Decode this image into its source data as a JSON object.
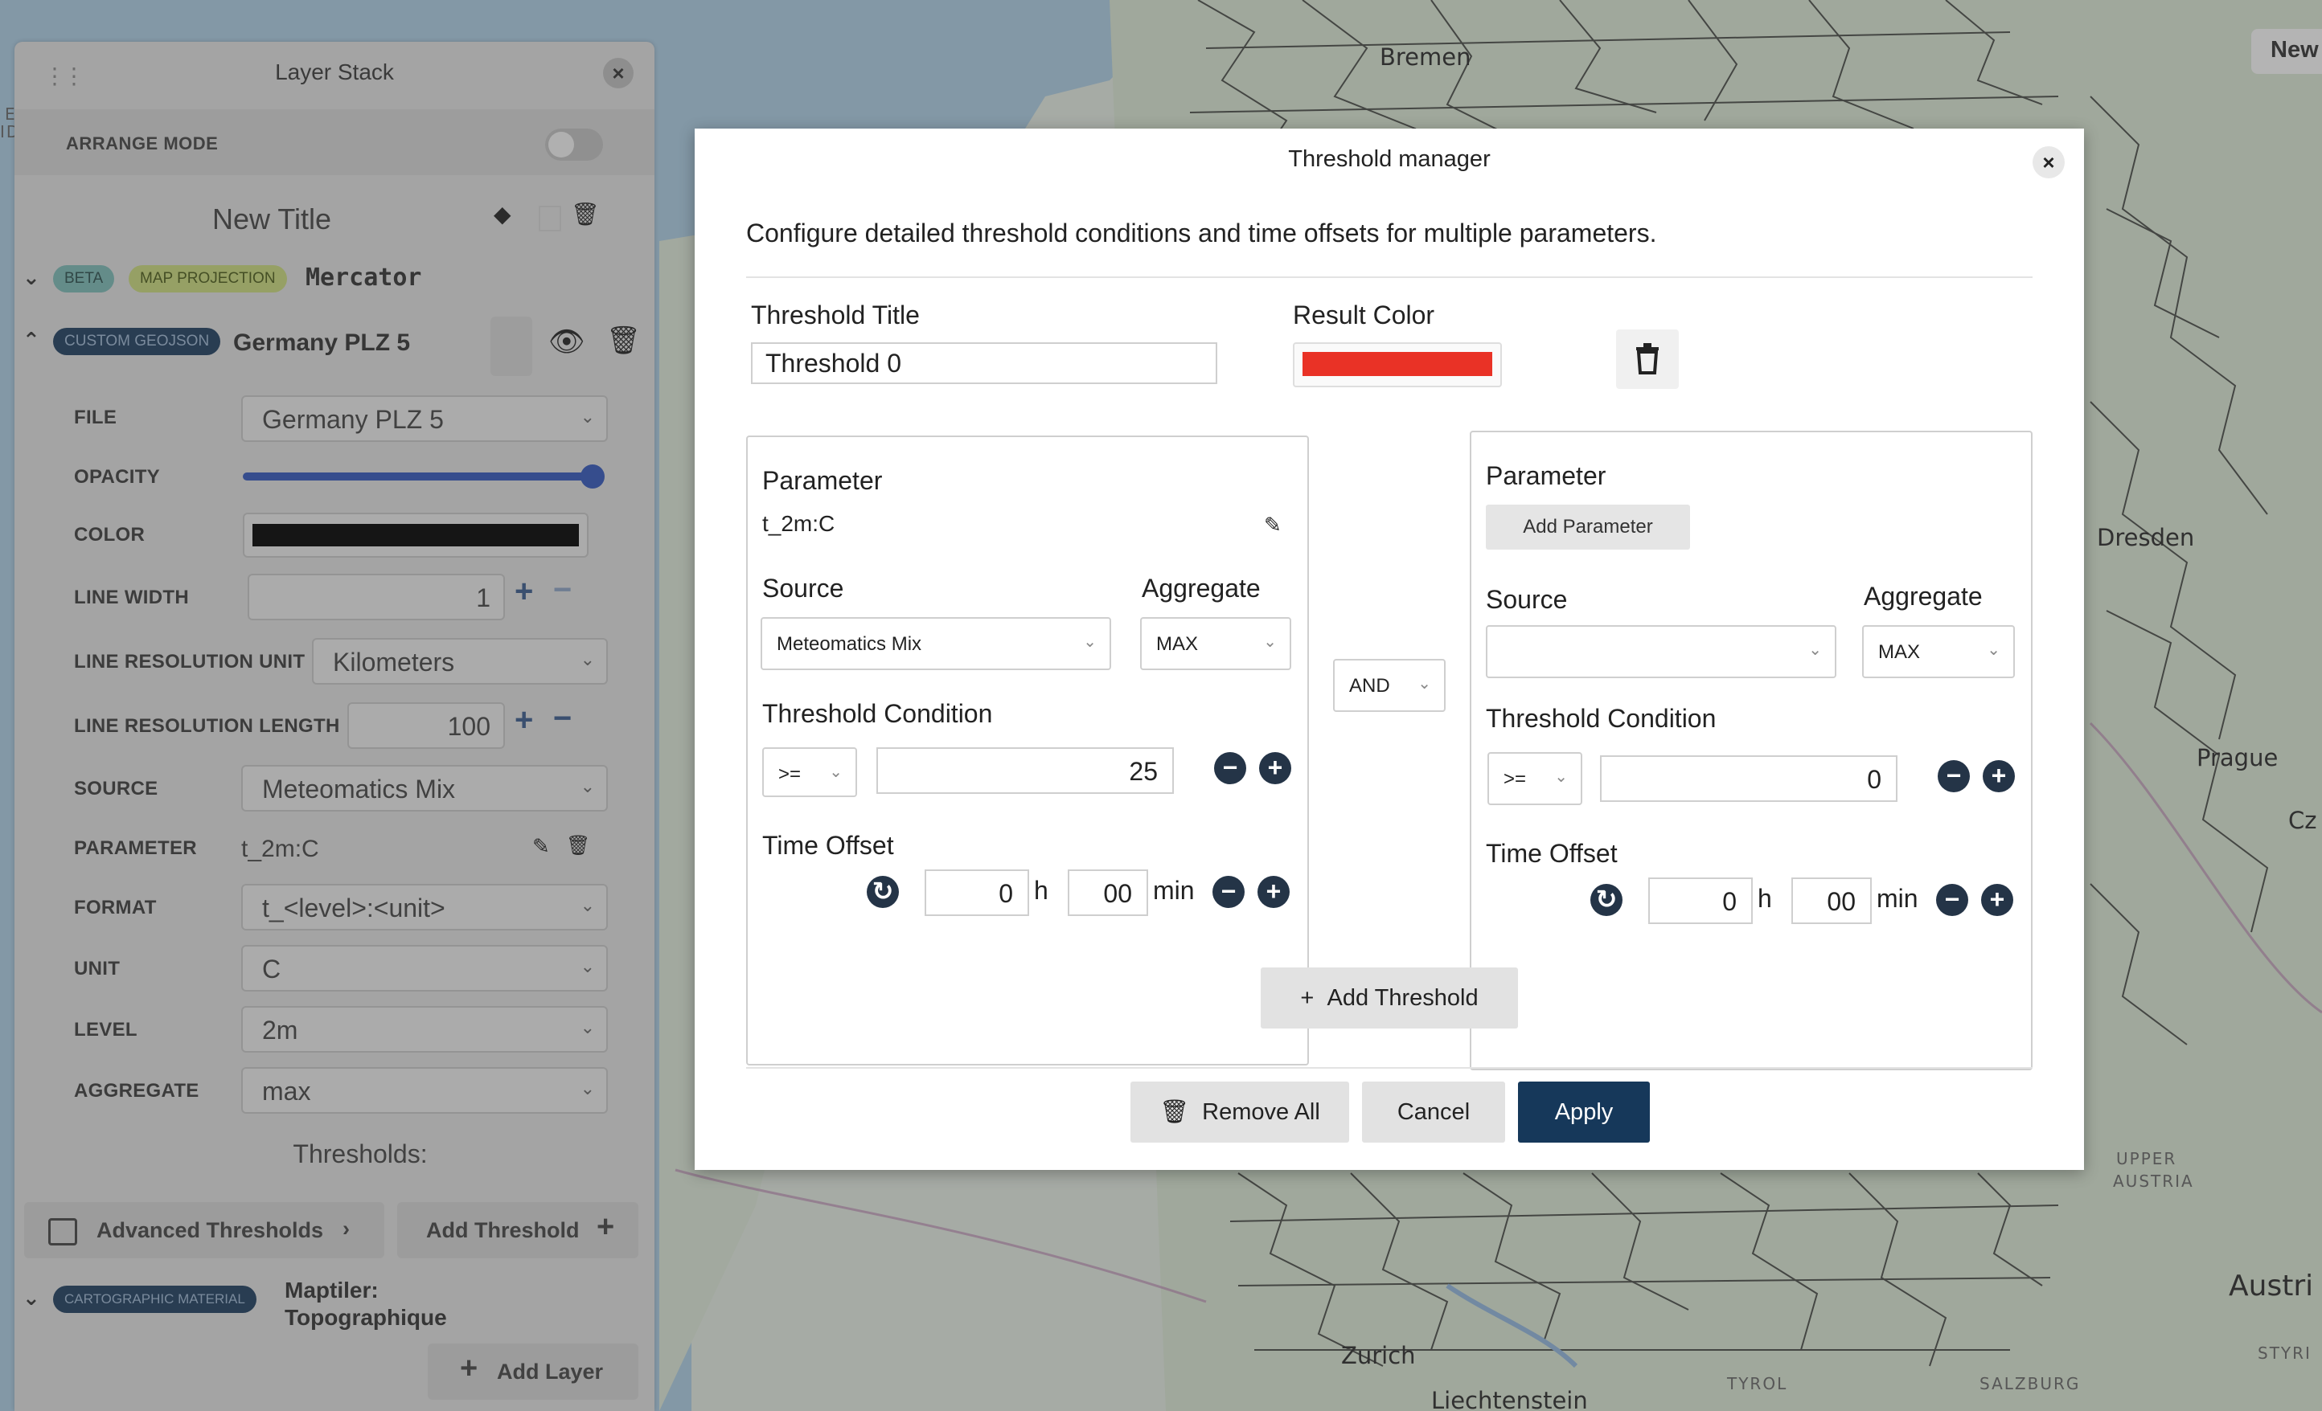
{
  "map": {
    "labels": {
      "bremen": "Bremen",
      "dresden": "Dresden",
      "prague": "Prague",
      "cz": "Cz",
      "zurich": "Zurich",
      "liechtenstein": "Liechtenstein",
      "austria": "Austri",
      "upper_austria_1": "UPPER",
      "upper_austria_2": "AUSTRIA",
      "tyrol": "TYROL",
      "salzburg": "SALZBURG",
      "styria": "STYRI",
      "edge_1": "E",
      "edge_2": "ID"
    },
    "new_button": "New"
  },
  "layer_stack": {
    "title": "Layer Stack",
    "arrange_mode_label": "ARRANGE MODE",
    "group_title": "New Title",
    "mercator": {
      "badges": [
        "BETA",
        "MAP PROJECTION"
      ],
      "title": "Mercator"
    },
    "geojson_layer": {
      "badge": "CUSTOM GEOJSON",
      "title": "Germany PLZ 5",
      "fields": {
        "file_label": "FILE",
        "file_value": "Germany PLZ 5",
        "opacity_label": "OPACITY",
        "opacity_value": 1.0,
        "color_label": "COLOR",
        "color_value": "#000000",
        "line_width_label": "LINE WIDTH",
        "line_width_value": "1",
        "line_res_unit_label": "LINE RESOLUTION UNIT",
        "line_res_unit_value": "Kilometers",
        "line_res_length_label": "LINE RESOLUTION LENGTH",
        "line_res_length_value": "100",
        "source_label": "SOURCE",
        "source_value": "Meteomatics Mix",
        "parameter_label": "PARAMETER",
        "parameter_value": "t_2m:C",
        "format_label": "FORMAT",
        "format_value": "t_<level>:<unit>",
        "unit_label": "UNIT",
        "unit_value": "C",
        "level_label": "LEVEL",
        "level_value": "2m",
        "aggregate_label": "AGGREGATE",
        "aggregate_value": "max"
      },
      "thresholds_heading": "Thresholds:",
      "advanced_thresholds": "Advanced Thresholds",
      "add_threshold": "Add Threshold"
    },
    "carto_layer": {
      "badge": "CARTOGRAPHIC MATERIAL",
      "title_line1": "Maptiler:",
      "title_line2": "Topographique"
    },
    "add_layer": "Add Layer"
  },
  "modal": {
    "title": "Threshold manager",
    "description": "Configure detailed threshold conditions and time offsets for multiple parameters.",
    "threshold_title_label": "Threshold Title",
    "threshold_title_value": "Threshold 0",
    "result_color_label": "Result Color",
    "result_color": "#e93226",
    "left_card": {
      "parameter_label": "Parameter",
      "parameter_value": "t_2m:C",
      "source_label": "Source",
      "source_value": "Meteomatics Mix",
      "aggregate_label": "Aggregate",
      "aggregate_value": "MAX",
      "condition_label": "Threshold Condition",
      "operator": ">=",
      "condition_value": "25",
      "time_offset_label": "Time Offset",
      "hours": "0",
      "hours_unit": "h",
      "minutes": "00",
      "minutes_unit": "min"
    },
    "logic_operator": "AND",
    "right_card": {
      "parameter_label": "Parameter",
      "add_parameter": "Add Parameter",
      "source_label": "Source",
      "source_value": "",
      "aggregate_label": "Aggregate",
      "aggregate_value": "MAX",
      "condition_label": "Threshold Condition",
      "operator": ">=",
      "condition_value": "0",
      "time_offset_label": "Time Offset",
      "hours": "0",
      "hours_unit": "h",
      "minutes": "00",
      "minutes_unit": "min"
    },
    "add_threshold": "Add Threshold",
    "remove_all": "Remove All",
    "cancel": "Cancel",
    "apply": "Apply"
  }
}
